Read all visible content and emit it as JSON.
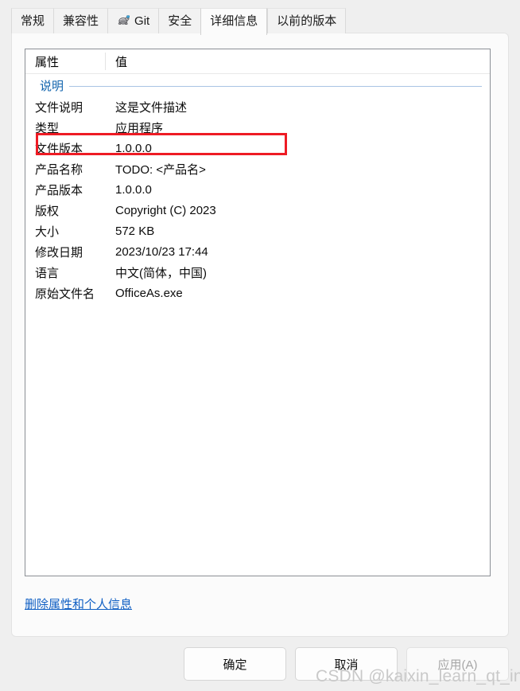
{
  "tabs": [
    {
      "label": "常规",
      "icon": null,
      "active": false
    },
    {
      "label": "兼容性",
      "icon": null,
      "active": false
    },
    {
      "label": "Git",
      "icon": "tortoise-git-icon",
      "active": false
    },
    {
      "label": "安全",
      "icon": null,
      "active": false
    },
    {
      "label": "详细信息",
      "icon": null,
      "active": true
    },
    {
      "label": "以前的版本",
      "icon": null,
      "active": false
    }
  ],
  "list": {
    "header": {
      "attribute": "属性",
      "value": "值"
    },
    "section": "说明",
    "rows": [
      {
        "name": "文件说明",
        "value": "这是文件描述",
        "highlighted": true
      },
      {
        "name": "类型",
        "value": "应用程序",
        "highlighted": false
      },
      {
        "name": "文件版本",
        "value": "1.0.0.0",
        "highlighted": false
      },
      {
        "name": "产品名称",
        "value": "TODO: <产品名>",
        "highlighted": false
      },
      {
        "name": "产品版本",
        "value": "1.0.0.0",
        "highlighted": false
      },
      {
        "name": "版权",
        "value": "Copyright (C) 2023",
        "highlighted": false
      },
      {
        "name": "大小",
        "value": "572 KB",
        "highlighted": false
      },
      {
        "name": "修改日期",
        "value": "2023/10/23 17:44",
        "highlighted": false
      },
      {
        "name": "语言",
        "value": "中文(简体，中国)",
        "highlighted": false
      },
      {
        "name": "原始文件名",
        "value": "OfficeAs.exe",
        "highlighted": false
      }
    ]
  },
  "remove_link": "删除属性和个人信息",
  "buttons": {
    "ok": "确定",
    "cancel": "取消",
    "apply": "应用(A)"
  },
  "watermark": "CSDN @kaixin_learn_qt_ing",
  "colors": {
    "accent_link": "#1160c4",
    "section_header": "#1063ad",
    "section_rule": "#a8c4e4",
    "highlight_box": "#ee1b24",
    "panel_border": "#8b8f95",
    "page_bg": "#fbfbfb",
    "dialog_bg": "#efefef",
    "watermark": "#c9c9c9"
  }
}
